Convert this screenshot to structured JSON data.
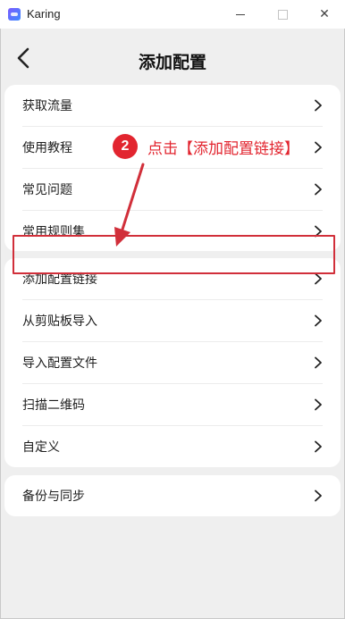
{
  "window": {
    "app_name": "Karing",
    "close_glyph": "✕"
  },
  "header": {
    "title": "添加配置",
    "back_icon": "chevron-left-icon"
  },
  "groups": [
    {
      "items": [
        {
          "label": "获取流量"
        },
        {
          "label": "使用教程"
        },
        {
          "label": "常见问题"
        },
        {
          "label": "常用规则集"
        }
      ]
    },
    {
      "items": [
        {
          "label": "添加配置链接"
        },
        {
          "label": "从剪贴板导入"
        },
        {
          "label": "导入配置文件"
        },
        {
          "label": "扫描二维码"
        },
        {
          "label": "自定义"
        }
      ]
    },
    {
      "items": [
        {
          "label": "备份与同步"
        }
      ]
    }
  ],
  "annotation": {
    "step_number": "2",
    "step_text": "点击【添加配置链接】",
    "color": "#e2252f"
  },
  "colors": {
    "background": "#efefef",
    "card": "#ffffff",
    "highlight": "#d12f3a"
  }
}
